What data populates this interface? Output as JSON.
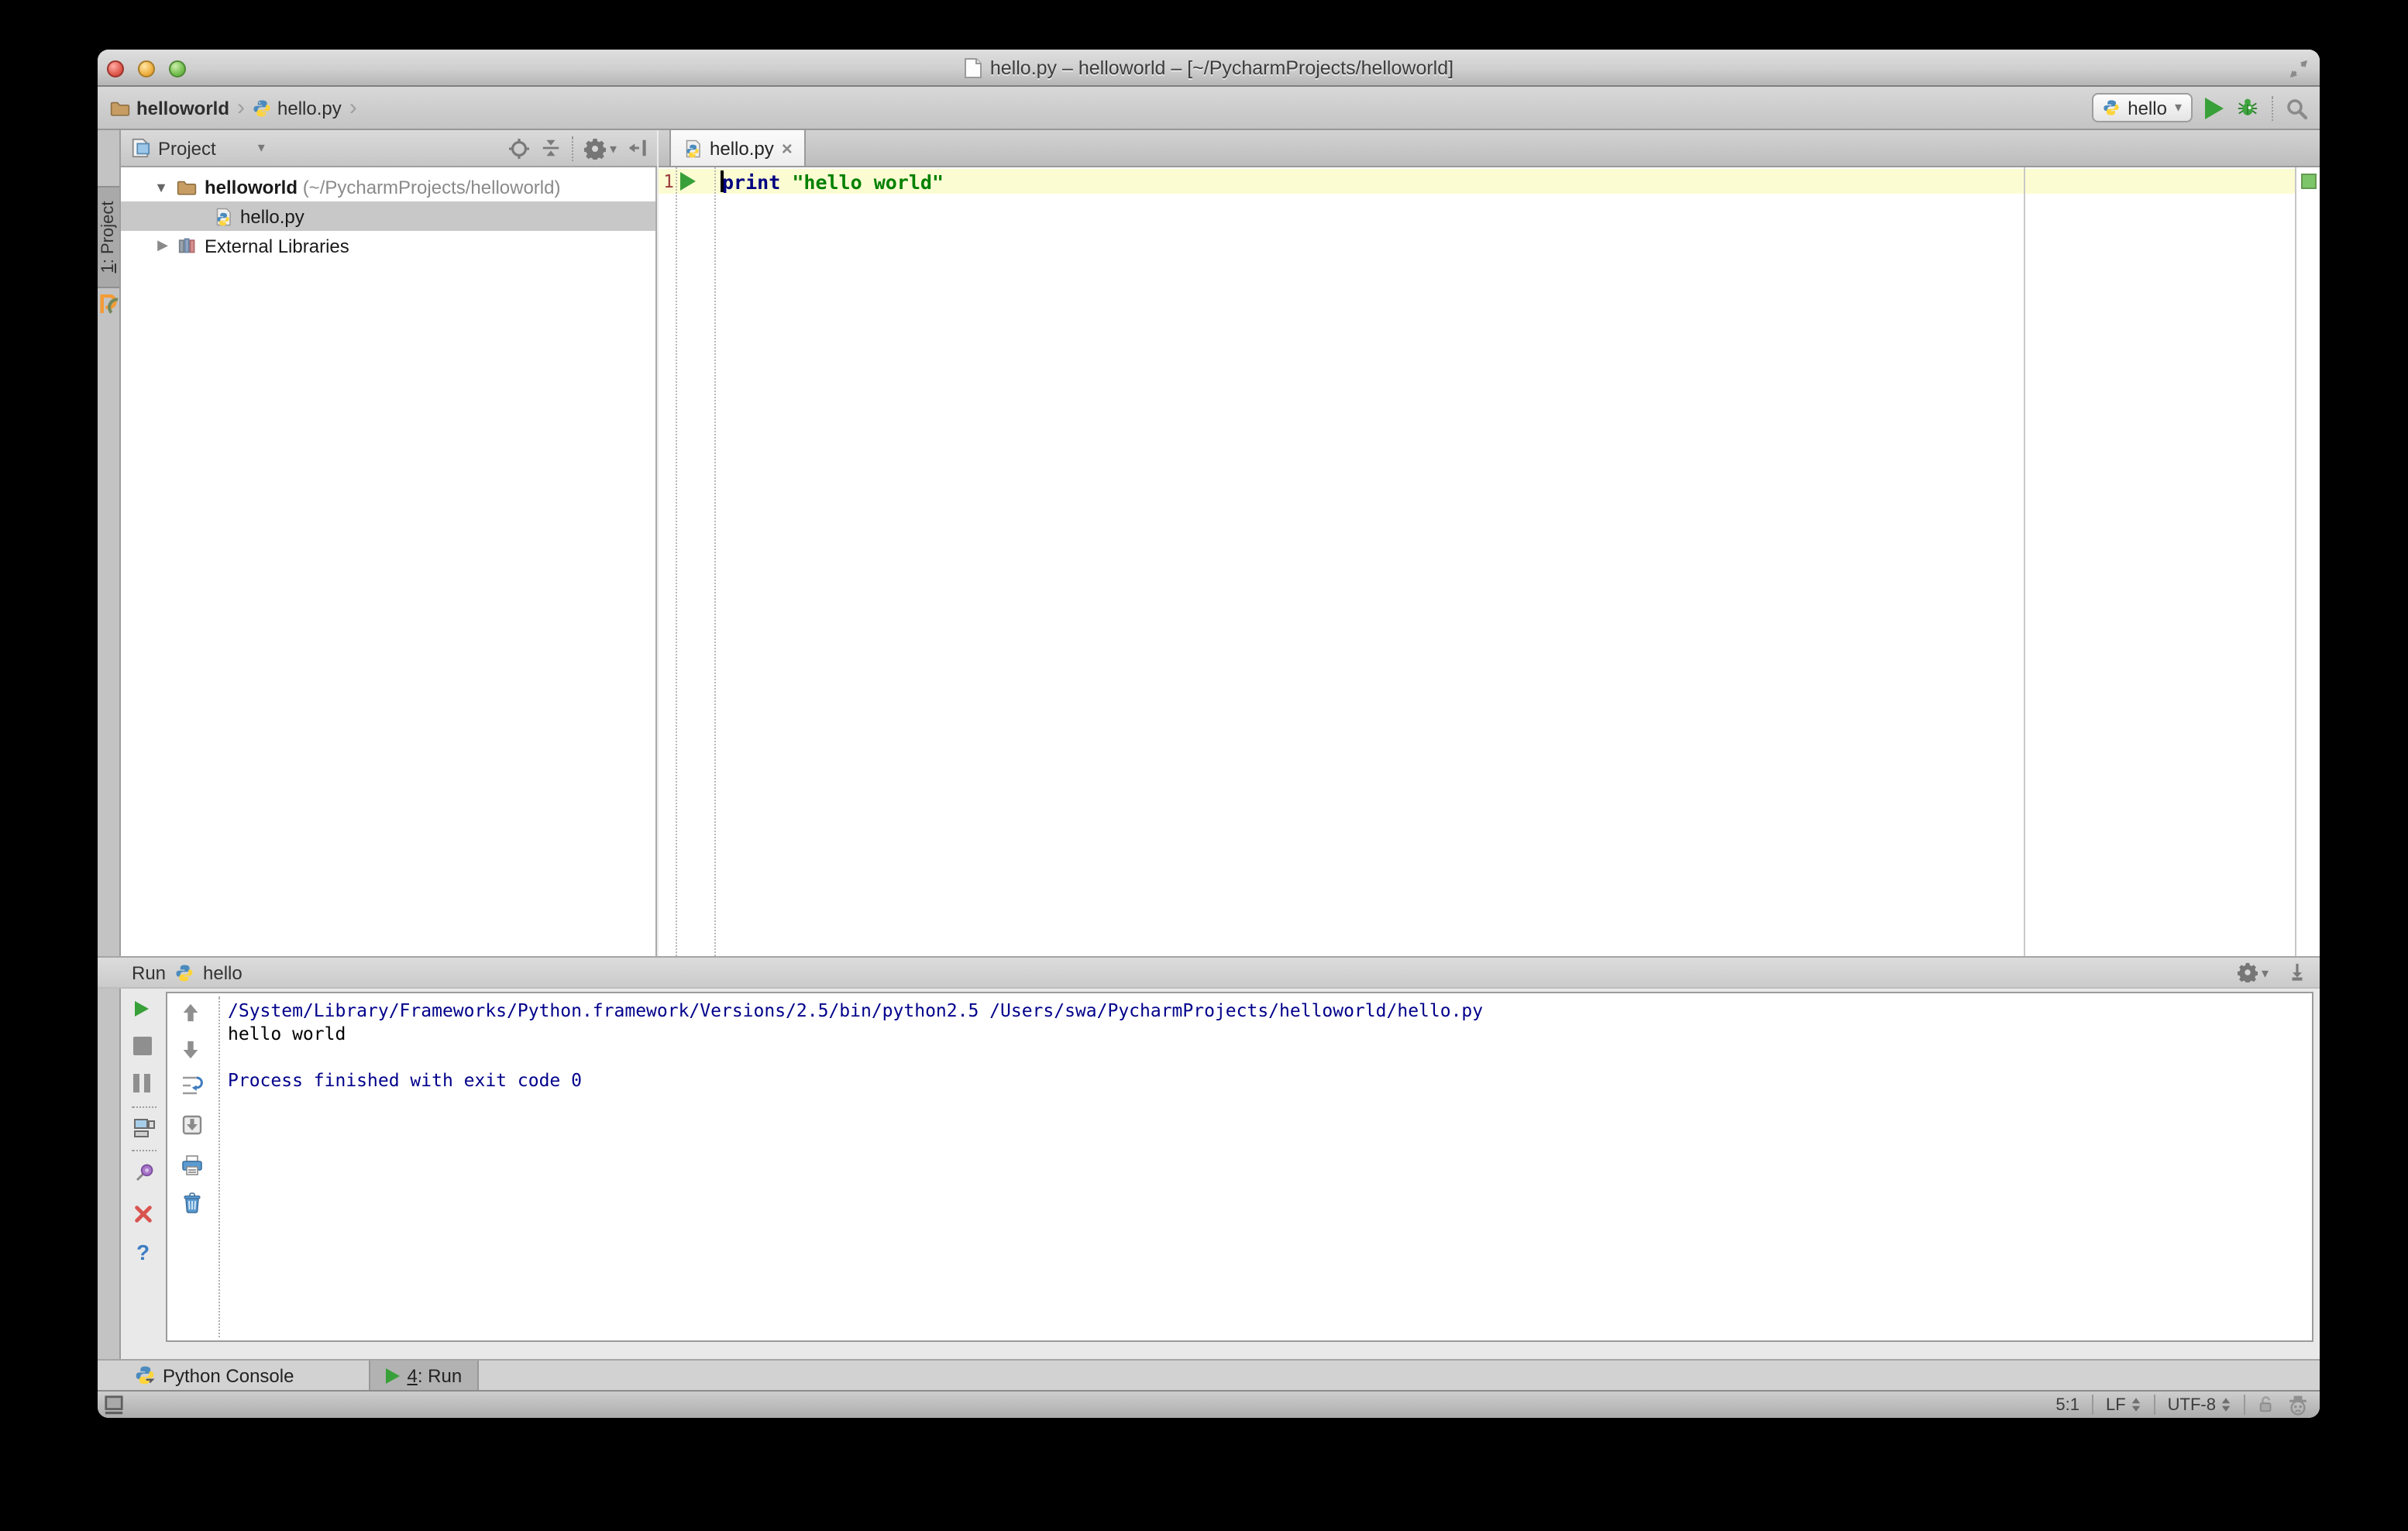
{
  "window": {
    "title": "hello.py – helloworld – [~/PycharmProjects/helloworld]"
  },
  "breadcrumbs": {
    "project": "helloworld",
    "file": "hello.py"
  },
  "toolbar": {
    "run_config_name": "hello"
  },
  "tool_stripe": {
    "project_button": {
      "number": "1",
      "rest": ": Project"
    }
  },
  "project_panel": {
    "header_label": "Project",
    "tree": {
      "root_name": "helloworld",
      "root_path": "(~/PycharmProjects/helloworld)",
      "file": "hello.py",
      "libraries": "External Libraries"
    }
  },
  "editor": {
    "tab_label": "hello.py",
    "line_number": "1",
    "code": {
      "keyword": "print",
      "string": "\"hello world\""
    }
  },
  "run_panel": {
    "title": "Run",
    "config_name": "hello",
    "console": {
      "command_line": "/System/Library/Frameworks/Python.framework/Versions/2.5/bin/python2.5 /Users/swa/PycharmProjects/helloworld/hello.py",
      "stdout_line": "hello world",
      "exit_line": "Process finished with exit code 0"
    }
  },
  "bottom_bar": {
    "python_console_tab": "Python Console",
    "run_tab": {
      "number": "4",
      "rest": ": Run"
    }
  },
  "status_bar": {
    "caret_position": "5:1",
    "line_separator": "LF",
    "encoding": "UTF-8"
  },
  "glyphs": {
    "chevron": "›",
    "dropdown": "▾",
    "expanded": "▼",
    "collapsed": "▶",
    "close_tab": "×",
    "help": "?"
  },
  "colors": {
    "keyword": "#000080",
    "string": "#008000",
    "console_info": "#00008b",
    "caret_line_bg": "#fcfcd2",
    "run_green": "#38a038"
  }
}
